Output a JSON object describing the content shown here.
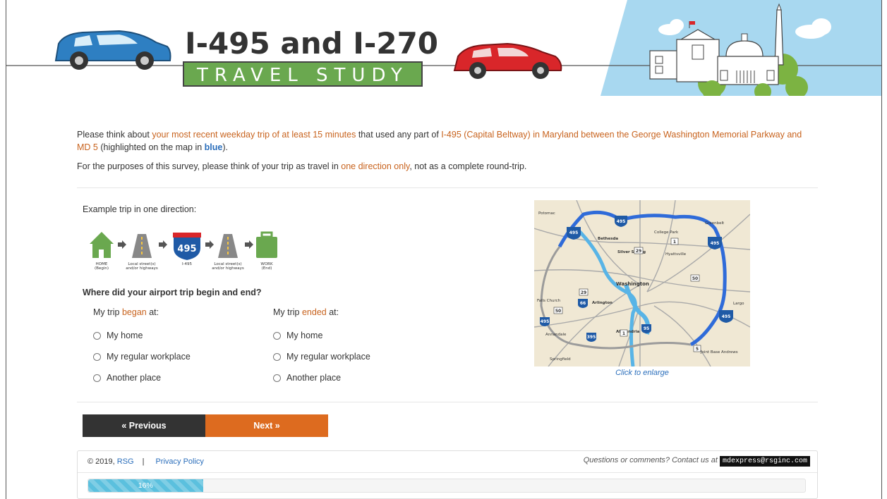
{
  "header": {
    "title_line1": "I-495 and I-270",
    "title_line2": "TRAVEL STUDY"
  },
  "intro": {
    "p1_a": "Please think about ",
    "p1_hl1": "your most recent weekday trip of at least 15 minutes",
    "p1_b": " that used any part of ",
    "p1_hl2": "I-495 (Capital Beltway) in Maryland between the George Washington Memorial Parkway and MD 5",
    "p1_c": " (highlighted on the map in ",
    "p1_blue": "blue",
    "p1_d": ").",
    "p2_a": "For the purposes of this survey, please think of your trip as travel in ",
    "p2_hl": "one direction only",
    "p2_b": ", not as a complete round-trip."
  },
  "example": {
    "label": "Example trip in one direction:",
    "shield": "495",
    "steps": [
      {
        "l1": "HOME",
        "l2": "(Begin)"
      },
      {
        "l1": "Local street(s)",
        "l2": "and/or highways"
      },
      {
        "l1": "I-495",
        "l2": ""
      },
      {
        "l1": "Local street(s)",
        "l2": "and/or highways"
      },
      {
        "l1": "WORK",
        "l2": "(End)"
      }
    ]
  },
  "question": {
    "text": "Where did your airport trip begin and end?",
    "began": {
      "a": "My trip ",
      "hl": "began",
      "b": " at:"
    },
    "ended": {
      "a": "My trip ",
      "hl": "ended",
      "b": " at:"
    },
    "options": [
      "My home",
      "My regular workplace",
      "Another place"
    ]
  },
  "map": {
    "caption": "Click to enlarge",
    "places": [
      "Potomac",
      "Silver Spring",
      "College Park",
      "Greenbelt",
      "Bethesda",
      "Hyattsville",
      "Washington",
      "Falls Church",
      "Arlington",
      "Largo",
      "Annandale",
      "Alexandria",
      "Springfield",
      "Joint Base Andrews"
    ],
    "shields": [
      "495",
      "495",
      "495",
      "495",
      "29",
      "1",
      "50",
      "29",
      "50",
      "66",
      "1",
      "395",
      "495",
      "5",
      "95"
    ]
  },
  "nav": {
    "prev": "« Previous",
    "next": "Next »"
  },
  "footer": {
    "copyright": "© 2019, ",
    "rsg": "RSG",
    "separator": "|",
    "privacy": "Privacy Policy",
    "contact": "Questions or comments? Contact us at",
    "email": "mdexpress@rsginc.com",
    "progress_label": "16%",
    "progress_value": 16
  },
  "colors": {
    "accent_orange": "#c8631e",
    "next_button": "#dd6b1f",
    "prev_button": "#333333",
    "progress": "#5bc0de",
    "sky": "#a8d8f0",
    "title_green": "#6aa84f"
  }
}
